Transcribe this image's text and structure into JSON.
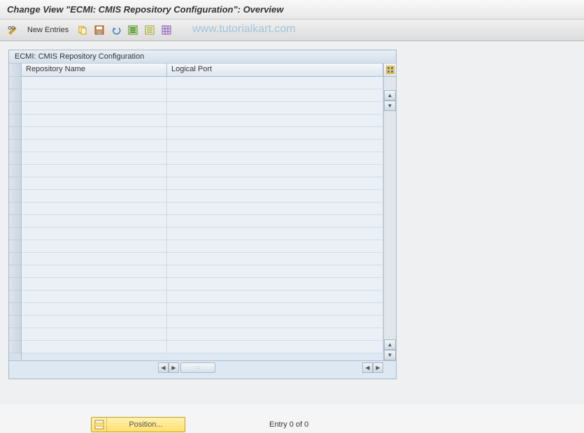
{
  "title": "Change View \"ECMI: CMIS Repository Configuration\": Overview",
  "toolbar": {
    "new_entries": "New Entries"
  },
  "watermark": "www.tutorialkart.com",
  "panel": {
    "title": "ECMI: CMIS Repository Configuration",
    "columns": {
      "repository_name": "Repository Name",
      "logical_port": "Logical Port"
    }
  },
  "footer": {
    "position_label": "Position...",
    "entry_text": "Entry 0 of 0"
  }
}
